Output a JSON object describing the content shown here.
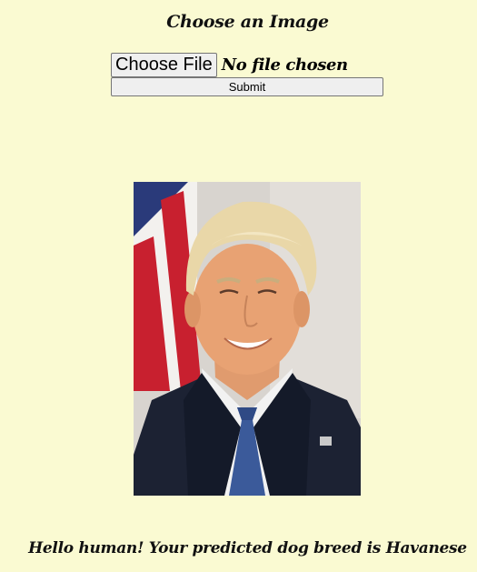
{
  "form": {
    "heading": "Choose an Image",
    "choose_button_label": "Choose File",
    "no_file_text": "No file chosen",
    "submit_label": "Submit"
  },
  "image": {
    "subject": "portrait-photo"
  },
  "result": {
    "text": "Hello human! Your predicted dog breed is Havanese"
  },
  "colors": {
    "page_background": "#fafad2",
    "button_background": "#efefef",
    "button_border": "#767676"
  }
}
